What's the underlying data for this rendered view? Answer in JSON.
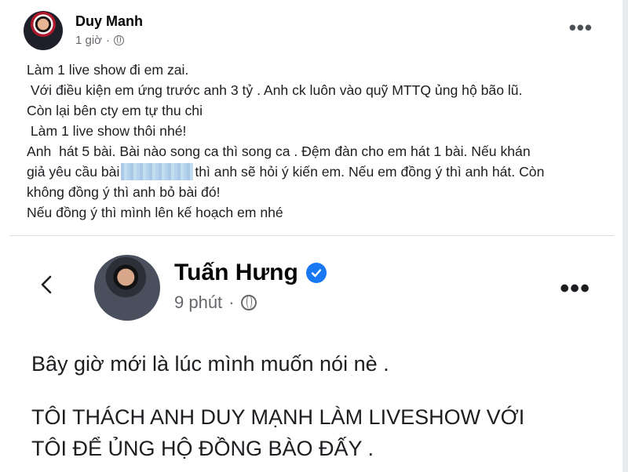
{
  "post": {
    "author": "Duy Manh",
    "time": "1 giờ",
    "separator": "·",
    "privacy_icon": "globe-icon",
    "more_icon": "more-options-icon",
    "more_glyph": "•••",
    "lines": [
      "Làm 1 live show đi em zai.",
      " Với điều kiện em ứng trước anh 3 tỷ . Anh ck luôn vào quỹ MTTQ ủng hộ bão lũ.",
      "Còn lại bên cty em tự thu chi",
      " Làm 1 live show thôi nhé!",
      "Anh  hát 5 bài. Bài nào song ca thì song ca . Đệm đàn cho em hát 1 bài. Nếu khán"
    ],
    "line6_before": "giả yêu cầu bài",
    "line6_after": "thì anh sẽ hỏi ý kiến em. Nếu em đồng ý thì anh hát. Còn",
    "line7": "không đồng ý thì anh bỏ bài đó!",
    "line8": "Nếu đồng ý thì mình lên kế hoạch em nhé"
  },
  "shared": {
    "back_icon": "back-arrow-icon",
    "author": "Tuấn Hưng",
    "verified_icon": "verified-badge-icon",
    "time": "9 phút",
    "separator": "·",
    "privacy_icon": "globe-icon",
    "more_glyph": "•••",
    "line1": "Bây giờ mới là lúc mình muốn nói nè .",
    "line2": "TÔI THÁCH ANH DUY MẠNH LÀM LIVESHOW VỚI",
    "line3": "TÔI ĐỂ ỦNG HỘ ĐỒNG BÀO ĐẤY ."
  },
  "colors": {
    "verified": "#1877f2",
    "meta_text": "#65676b",
    "text": "#1c1e21"
  }
}
